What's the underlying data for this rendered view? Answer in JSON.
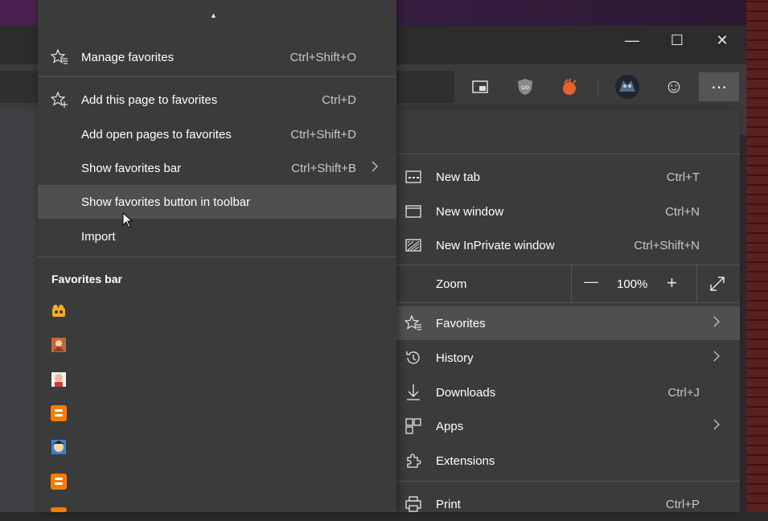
{
  "window": {
    "minimize_glyph": "—",
    "maximize_glyph": "☐",
    "close_glyph": "✕"
  },
  "toolbar": {
    "more_glyph": "⋯",
    "emoji_glyph": "☺"
  },
  "favorites_submenu": {
    "scroll_up_glyph": "▲",
    "items": [
      {
        "label": "Manage favorites",
        "shortcut": "Ctrl+Shift+O",
        "icon": "star-list-icon"
      },
      {
        "label": "Add this page to favorites",
        "shortcut": "Ctrl+D",
        "icon": "star-add-icon"
      },
      {
        "label": "Add open pages to favorites",
        "shortcut": "Ctrl+Shift+D",
        "icon": ""
      },
      {
        "label": "Show favorites bar",
        "shortcut": "Ctrl+Shift+B",
        "icon": "",
        "has_submenu": true
      },
      {
        "label": "Show favorites button in toolbar",
        "shortcut": "",
        "icon": "",
        "highlighted": true
      },
      {
        "label": "Import",
        "shortcut": "",
        "icon": ""
      }
    ],
    "section_header": "Favorites bar"
  },
  "main_menu": {
    "items": [
      {
        "label": "New tab",
        "shortcut": "Ctrl+T",
        "icon": "new-tab-icon"
      },
      {
        "label": "New window",
        "shortcut": "Ctrl+N",
        "icon": "new-window-icon"
      },
      {
        "label": "New InPrivate window",
        "shortcut": "Ctrl+Shift+N",
        "icon": "inprivate-icon"
      },
      {
        "label": "Favorites",
        "icon": "favorites-icon",
        "has_submenu": true,
        "highlighted": true
      },
      {
        "label": "History",
        "icon": "history-icon",
        "has_submenu": true
      },
      {
        "label": "Downloads",
        "shortcut": "Ctrl+J",
        "icon": "download-icon"
      },
      {
        "label": "Apps",
        "icon": "apps-icon",
        "has_submenu": true
      },
      {
        "label": "Extensions",
        "icon": "extensions-icon"
      },
      {
        "label": "Print",
        "shortcut": "Ctrl+P",
        "icon": "print-icon"
      }
    ],
    "zoom": {
      "label": "Zoom",
      "value": "100%",
      "minus": "—",
      "plus": "+"
    }
  },
  "colors": {
    "menu_bg": "#3b3b3b",
    "highlight": "#4f4f4f",
    "separator": "#545454"
  }
}
